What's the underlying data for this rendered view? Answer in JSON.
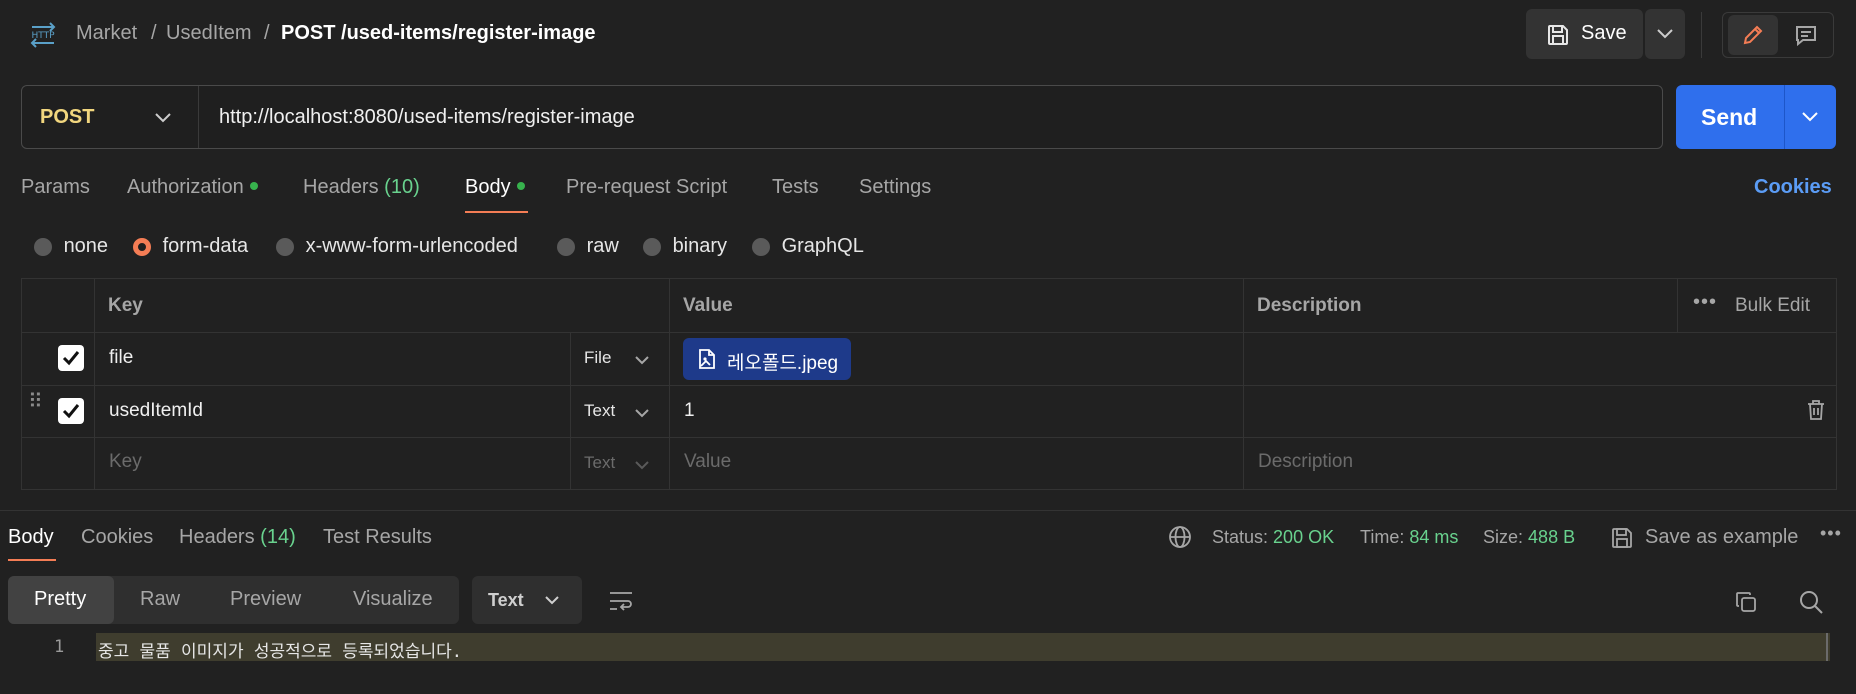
{
  "header": {
    "logo_text": "HTTP",
    "breadcrumb": [
      "Market",
      "UsedItem"
    ],
    "separator": "/",
    "request_title": "POST /used-items/register-image",
    "save_label": "Save"
  },
  "request": {
    "method": "POST",
    "url": "http://localhost:8080/used-items/register-image",
    "send_label": "Send"
  },
  "tabs": {
    "params": "Params",
    "authorization": "Authorization",
    "headers": "Headers",
    "headers_count": "(10)",
    "body": "Body",
    "prerequest": "Pre-request Script",
    "tests": "Tests",
    "settings": "Settings",
    "cookies": "Cookies"
  },
  "body_types": [
    "none",
    "form-data",
    "x-www-form-urlencoded",
    "raw",
    "binary",
    "GraphQL"
  ],
  "selected_body_type": "form-data",
  "table": {
    "headers": {
      "key": "Key",
      "value": "Value",
      "description": "Description",
      "bulk_edit": "Bulk Edit"
    },
    "rows": [
      {
        "checked": true,
        "key": "file",
        "type": "File",
        "value": "레오폴드.jpeg"
      },
      {
        "checked": true,
        "key": "usedItemId",
        "type": "Text",
        "value": "1"
      }
    ],
    "placeholder": {
      "key": "Key",
      "type": "Text",
      "value": "Value",
      "description": "Description"
    }
  },
  "response": {
    "tabs": {
      "body": "Body",
      "cookies": "Cookies",
      "headers": "Headers",
      "headers_count": "(14)",
      "test_results": "Test Results"
    },
    "status_label": "Status:",
    "status_value": "200 OK",
    "time_label": "Time:",
    "time_value": "84 ms",
    "size_label": "Size:",
    "size_value": "488 B",
    "save_example": "Save as example",
    "view_modes": [
      "Pretty",
      "Raw",
      "Preview",
      "Visualize"
    ],
    "format": "Text",
    "line_number": "1",
    "body_text": "중고 물품 이미지가 성공적으로 등록되었습니다."
  },
  "colors": {
    "accent_orange": "#f47d55",
    "send_blue": "#2f6fed",
    "status_green": "#69d28e",
    "cookies_link": "#5b9cf5",
    "method_yellow": "#f1d67e"
  }
}
